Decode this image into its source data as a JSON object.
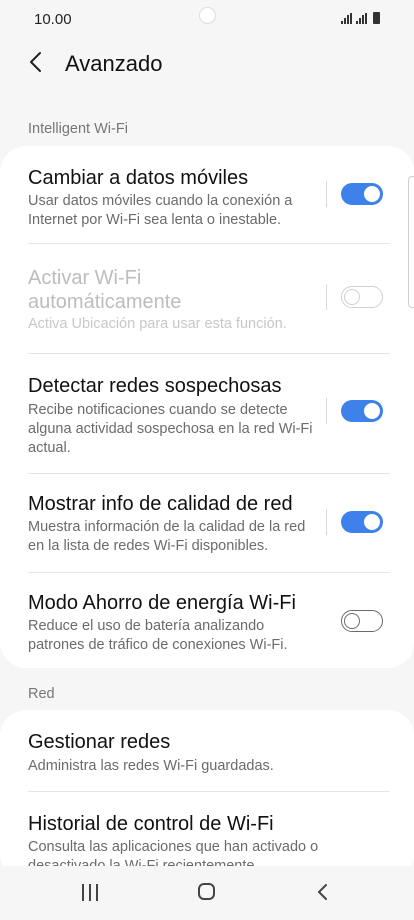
{
  "status": {
    "time": "10.00"
  },
  "header": {
    "title": "Avanzado"
  },
  "sections": {
    "intelligent": "Intelligent Wi-Fi",
    "red": "Red"
  },
  "settings": [
    {
      "title": "Cambiar a datos móviles",
      "desc": "Usar datos móviles cuando la conexión a Internet por Wi-Fi sea lenta o inestable.",
      "toggle": "on"
    },
    {
      "title": "Activar Wi-Fi automáticamente",
      "desc": "Activa Ubicación para usar esta función.",
      "toggle": "off-disabled"
    },
    {
      "title": "Detectar redes sospechosas",
      "desc": "Recibe notificaciones cuando se detecte alguna actividad sospechosa en la red Wi-Fi actual.",
      "toggle": "on"
    },
    {
      "title": "Mostrar info de calidad de red",
      "desc": "Muestra información de la calidad de la red en la lista de redes Wi-Fi disponibles.",
      "toggle": "on"
    },
    {
      "title": "Modo Ahorro de energía Wi-Fi",
      "desc": "Reduce el uso de batería analizando patrones de tráfico de conexiones Wi-Fi.",
      "toggle": "off"
    }
  ],
  "network": [
    {
      "title": "Gestionar redes",
      "desc": "Administra las redes Wi-Fi guardadas."
    },
    {
      "title": "Historial de control de Wi-Fi",
      "desc": "Consulta las aplicaciones que han activado o desactivado la Wi-Fi recientemente."
    }
  ],
  "colors": {
    "accent": "#3e81ea",
    "background": "#f6f6f6",
    "card": "#ffffff"
  }
}
